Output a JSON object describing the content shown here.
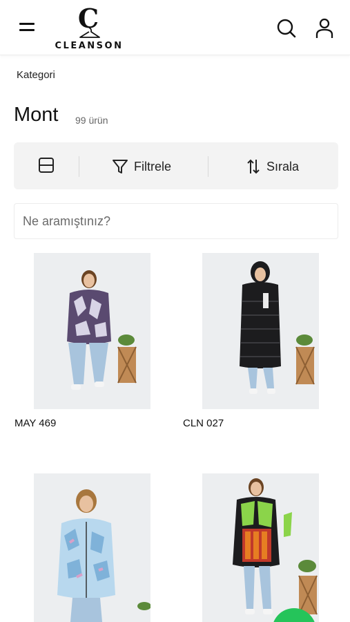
{
  "header": {
    "menu_icon": "hamburger-icon",
    "logo_letter": "C",
    "logo_text": "CLEANSON",
    "search_icon": "search-icon",
    "account_icon": "user-icon"
  },
  "breadcrumb": "Kategori",
  "category": {
    "title": "Mont",
    "count": "99 ürün"
  },
  "toolbar": {
    "layout_icon": "grid-layout-icon",
    "filter_label": "Filtrele",
    "sort_label": "Sırala"
  },
  "search": {
    "placeholder": "Ne aramıştınız?"
  },
  "products": [
    {
      "name": "MAY 469",
      "image": "model-printed-puffer-jacket"
    },
    {
      "name": "CLN 027",
      "image": "model-black-long-puffer-coat"
    },
    {
      "name": "",
      "image": "model-blue-floral-hooded-jacket"
    },
    {
      "name": "",
      "image": "model-green-patterned-jacket"
    }
  ],
  "colors": {
    "accent_green": "#25c45a",
    "toolbar_bg": "#f3f3f3",
    "photo_bg": "#eceef0"
  }
}
